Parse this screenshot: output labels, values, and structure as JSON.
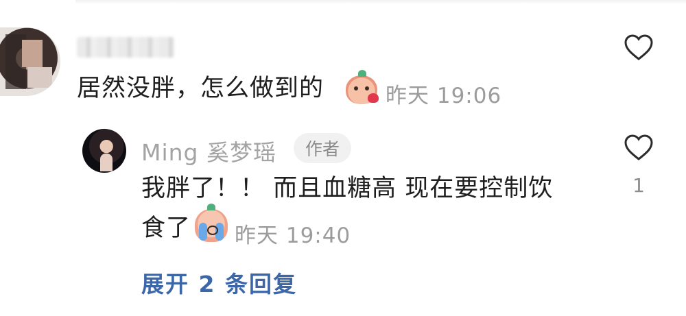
{
  "comment": {
    "text": "居然没胖，怎么做到的",
    "emoji": "kiss-emoji",
    "time": "昨天 19:06"
  },
  "reply": {
    "author": "Ming 奚梦瑶",
    "badge": "作者",
    "line1": "我胖了！！ 而且血糖高 现在要控制饮",
    "line2": "食了",
    "emoji": "crying-emoji",
    "time": "昨天 19:40",
    "likes": "1"
  },
  "expand_label": "展开 2 条回复"
}
